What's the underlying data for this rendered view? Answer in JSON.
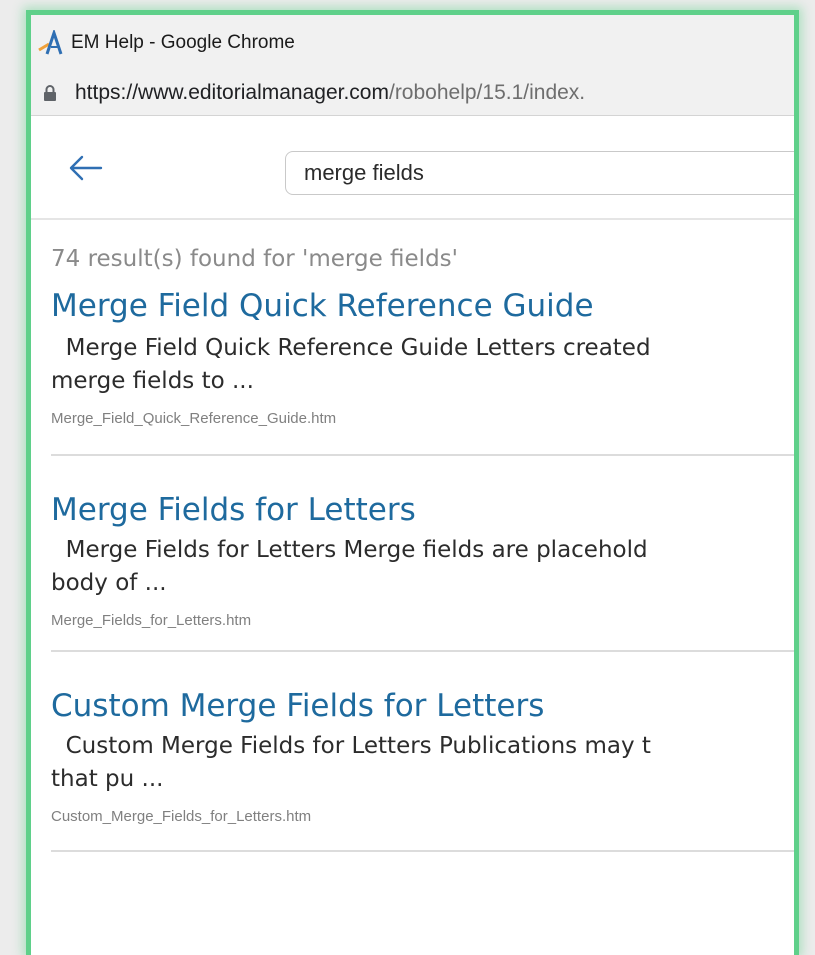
{
  "window": {
    "title": "EM Help - Google Chrome",
    "url_host": "https://www.editorialmanager.com",
    "url_path": "/robohelp/15.1/index."
  },
  "search": {
    "query": "merge fields",
    "summary": "74 result(s) found for 'merge fields'"
  },
  "results": [
    {
      "title": "Merge Field Quick Reference Guide",
      "snippet_line1": "  Merge Field Quick Reference Guide Letters created",
      "snippet_line2": "merge fields to ...",
      "file": "Merge_Field_Quick_Reference_Guide.htm"
    },
    {
      "title": "Merge Fields for Letters",
      "snippet_line1": "  Merge Fields for Letters Merge fields are placehold",
      "snippet_line2": "body of ...",
      "file": "Merge_Fields_for_Letters.htm"
    },
    {
      "title": "Custom Merge Fields for Letters",
      "snippet_line1": "  Custom Merge Fields for Letters Publications may t",
      "snippet_line2": "that pu ...",
      "file": "Custom_Merge_Fields_for_Letters.htm"
    }
  ],
  "colors": {
    "frame_border": "#5fd08a",
    "link": "#1e6a9e",
    "chrome_bg": "#f1f1f1"
  },
  "icons": {
    "app": "editorial-manager-logo-icon",
    "lock": "lock-icon",
    "back": "arrow-left-icon"
  }
}
